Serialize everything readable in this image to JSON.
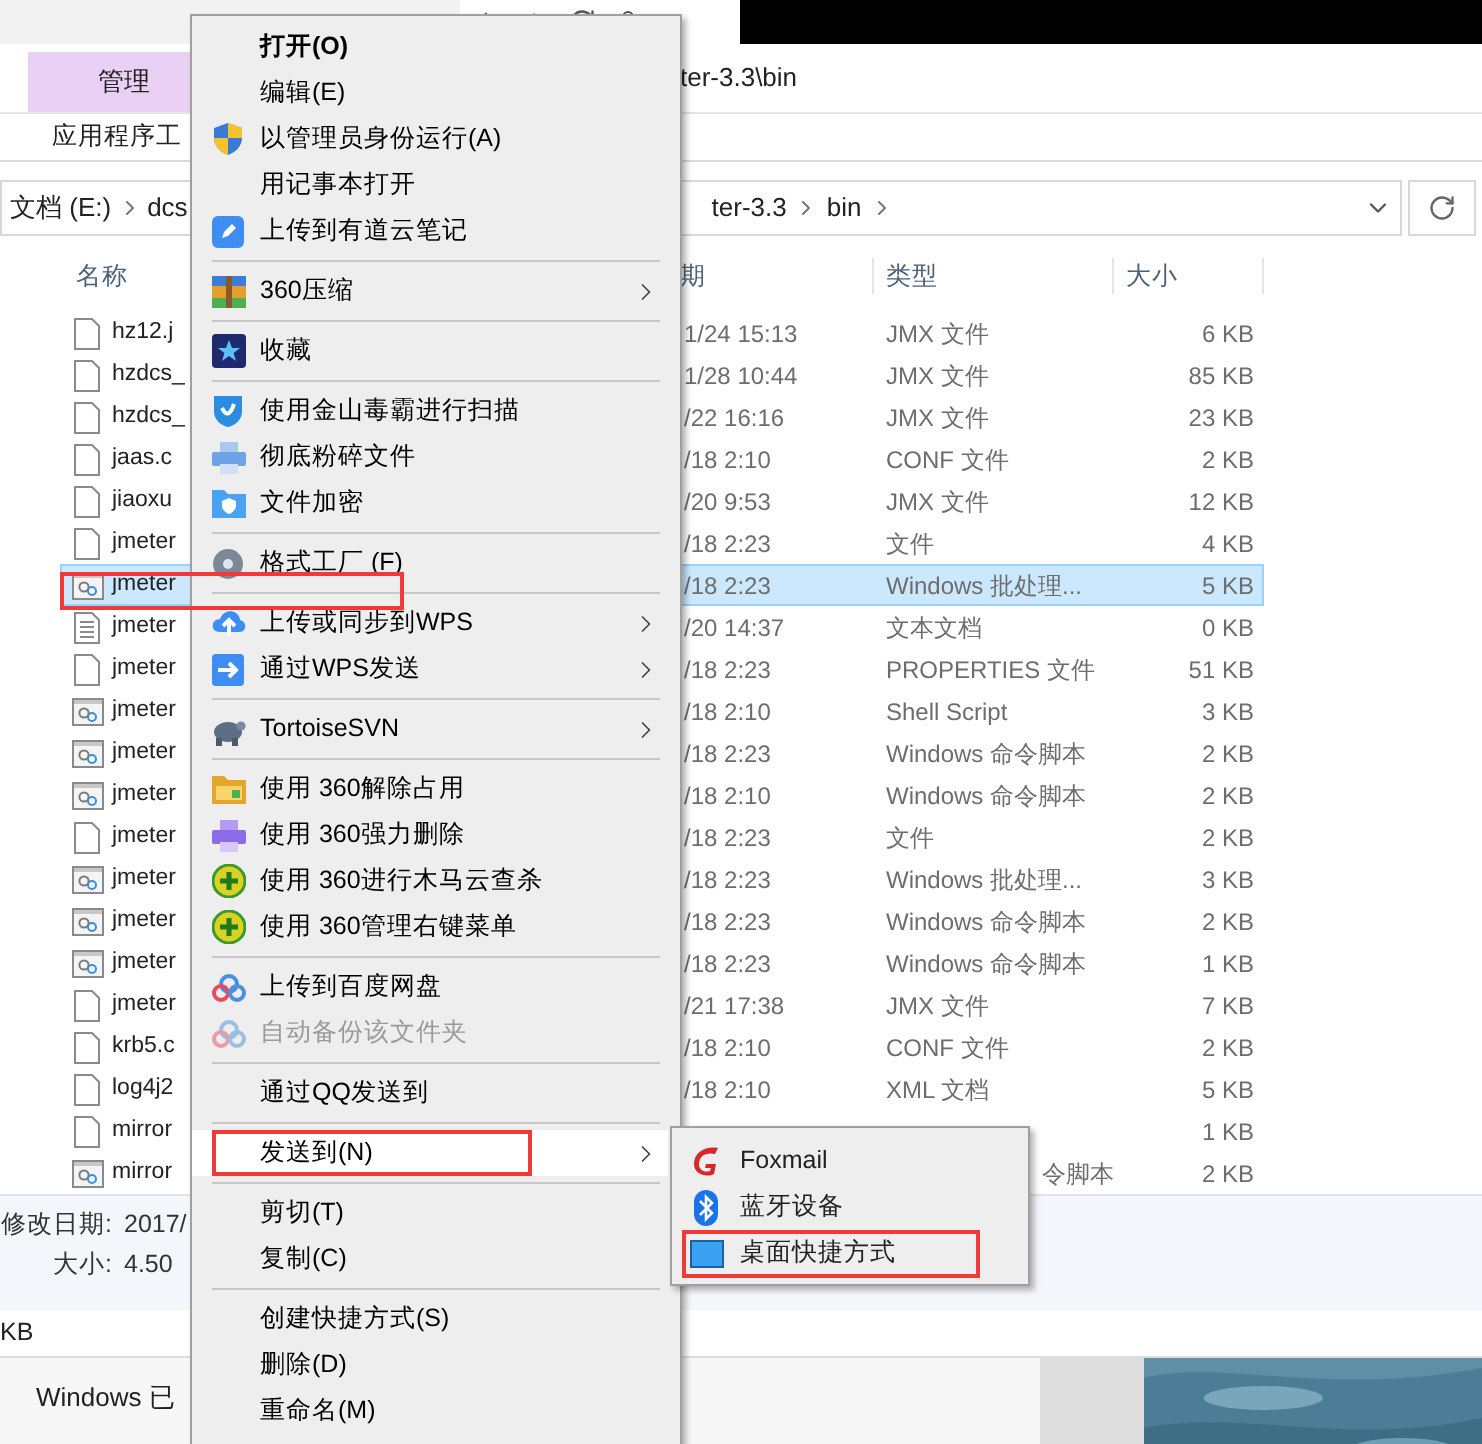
{
  "ribbon": {
    "tabs": [
      {
        "label": "管理",
        "selected": true
      }
    ],
    "tool_label": "应用程序工",
    "title": "ter-3.3\\bin"
  },
  "address": {
    "crumbs": [
      "文档 (E:)",
      "dcs",
      "ter-3.3",
      "bin"
    ]
  },
  "columns": [
    "名称",
    "期",
    "类型",
    "大小"
  ],
  "files": [
    {
      "kind": "file",
      "name": "hz12.j",
      "date": "1/24 15:13",
      "type": "JMX 文件",
      "size": "6 KB",
      "selected": false,
      "annotated": false
    },
    {
      "kind": "file",
      "name": "hzdcs_",
      "date": "1/28 10:44",
      "type": "JMX 文件",
      "size": "85 KB",
      "selected": false,
      "annotated": false
    },
    {
      "kind": "file",
      "name": "hzdcs_",
      "date": "/22 16:16",
      "type": "JMX 文件",
      "size": "23 KB",
      "selected": false,
      "annotated": false
    },
    {
      "kind": "file",
      "name": "jaas.c",
      "date": "/18 2:10",
      "type": "CONF 文件",
      "size": "2 KB",
      "selected": false,
      "annotated": false
    },
    {
      "kind": "file",
      "name": "jiaoxu",
      "date": "/20 9:53",
      "type": "JMX 文件",
      "size": "12 KB",
      "selected": false,
      "annotated": false
    },
    {
      "kind": "file",
      "name": "jmeter",
      "date": "/18 2:23",
      "type": "文件",
      "size": "4 KB",
      "selected": false,
      "annotated": false
    },
    {
      "kind": "script",
      "name": "jmeter",
      "date": "/18 2:23",
      "type": "Windows 批处理...",
      "size": "5 KB",
      "selected": true,
      "annotated": true
    },
    {
      "kind": "text",
      "name": "jmeter",
      "date": "/20 14:37",
      "type": "文本文档",
      "size": "0 KB",
      "selected": false,
      "annotated": false
    },
    {
      "kind": "file",
      "name": "jmeter",
      "date": "/18 2:23",
      "type": "PROPERTIES 文件",
      "size": "51 KB",
      "selected": false,
      "annotated": false
    },
    {
      "kind": "script",
      "name": "jmeter",
      "date": "/18 2:10",
      "type": "Shell Script",
      "size": "3 KB",
      "selected": false,
      "annotated": false
    },
    {
      "kind": "script",
      "name": "jmeter",
      "date": "/18 2:23",
      "type": "Windows 命令脚本",
      "size": "2 KB",
      "selected": false,
      "annotated": false
    },
    {
      "kind": "script",
      "name": "jmeter",
      "date": "/18 2:10",
      "type": "Windows 命令脚本",
      "size": "2 KB",
      "selected": false,
      "annotated": false
    },
    {
      "kind": "file",
      "name": "jmeter",
      "date": "/18 2:23",
      "type": "文件",
      "size": "2 KB",
      "selected": false,
      "annotated": false
    },
    {
      "kind": "script",
      "name": "jmeter",
      "date": "/18 2:23",
      "type": "Windows 批处理...",
      "size": "3 KB",
      "selected": false,
      "annotated": false
    },
    {
      "kind": "script",
      "name": "jmeter",
      "date": "/18 2:23",
      "type": "Windows 命令脚本",
      "size": "2 KB",
      "selected": false,
      "annotated": false
    },
    {
      "kind": "script",
      "name": "jmeter",
      "date": "/18 2:23",
      "type": "Windows 命令脚本",
      "size": "1 KB",
      "selected": false,
      "annotated": false
    },
    {
      "kind": "file",
      "name": "jmeter",
      "date": "/21 17:38",
      "type": "JMX 文件",
      "size": "7 KB",
      "selected": false,
      "annotated": false
    },
    {
      "kind": "file",
      "name": "krb5.c",
      "date": "/18 2:10",
      "type": "CONF 文件",
      "size": "2 KB",
      "selected": false,
      "annotated": false
    },
    {
      "kind": "file",
      "name": "log4j2",
      "date": "/18 2:10",
      "type": "XML 文档",
      "size": "5 KB",
      "selected": false,
      "annotated": false
    },
    {
      "kind": "file",
      "name": "mirror",
      "size": "1 KB",
      "selected": false,
      "annotated": false
    },
    {
      "kind": "script",
      "name": "mirror",
      "type": "令脚本",
      "partial": true,
      "size": "2 KB",
      "selected": false,
      "annotated": false
    }
  ],
  "details": [
    {
      "label": "修改日期:",
      "value": "2017/"
    },
    {
      "label": "大小:",
      "value": "4.50"
    }
  ],
  "status_bar": "KB",
  "desktop": {
    "notice": "Windows 已"
  },
  "context_menu": {
    "items": [
      {
        "kind": "default",
        "label": "打开(O)",
        "disabled": false,
        "submenu": false,
        "selected": false,
        "annotated": false
      },
      {
        "kind": "item",
        "label": "编辑(E)",
        "disabled": false,
        "submenu": false,
        "selected": false,
        "annotated": false
      },
      {
        "kind": "item",
        "label": "以管理员身份运行(A)",
        "disabled": false,
        "submenu": false,
        "selected": false,
        "annotated": false
      },
      {
        "kind": "item",
        "label": "用记事本打开",
        "disabled": false,
        "submenu": false,
        "selected": false,
        "annotated": false
      },
      {
        "kind": "item",
        "label": "上传到有道云笔记",
        "disabled": false,
        "submenu": false,
        "selected": false,
        "annotated": false
      },
      {
        "kind": "separator"
      },
      {
        "kind": "item",
        "label": "360压缩",
        "disabled": false,
        "submenu": true,
        "selected": false,
        "annotated": false
      },
      {
        "kind": "separator"
      },
      {
        "kind": "item",
        "label": "收藏",
        "disabled": false,
        "submenu": false,
        "selected": false,
        "annotated": false
      },
      {
        "kind": "separator"
      },
      {
        "kind": "item",
        "label": "使用金山毒霸进行扫描",
        "disabled": false,
        "submenu": false,
        "selected": false,
        "annotated": false
      },
      {
        "kind": "item",
        "label": "彻底粉碎文件",
        "disabled": false,
        "submenu": false,
        "selected": false,
        "annotated": false
      },
      {
        "kind": "item",
        "label": "文件加密",
        "disabled": false,
        "submenu": false,
        "selected": false,
        "annotated": false
      },
      {
        "kind": "separator"
      },
      {
        "kind": "item",
        "label": "格式工厂 (F)",
        "disabled": false,
        "submenu": false,
        "selected": false,
        "annotated": false
      },
      {
        "kind": "separator"
      },
      {
        "kind": "item",
        "label": "上传或同步到WPS",
        "disabled": false,
        "submenu": true,
        "selected": false,
        "annotated": false
      },
      {
        "kind": "item",
        "label": "通过WPS发送",
        "disabled": false,
        "submenu": true,
        "selected": false,
        "annotated": false
      },
      {
        "kind": "separator"
      },
      {
        "kind": "item",
        "label": "TortoiseSVN",
        "disabled": false,
        "submenu": true,
        "selected": false,
        "annotated": false
      },
      {
        "kind": "separator"
      },
      {
        "kind": "item",
        "label": "使用 360解除占用",
        "disabled": false,
        "submenu": false,
        "selected": false,
        "annotated": false
      },
      {
        "kind": "item",
        "label": "使用 360强力删除",
        "disabled": false,
        "submenu": false,
        "selected": false,
        "annotated": false
      },
      {
        "kind": "item",
        "label": "使用 360进行木马云查杀",
        "disabled": false,
        "submenu": false,
        "selected": false,
        "annotated": false
      },
      {
        "kind": "item",
        "label": "使用 360管理右键菜单",
        "disabled": false,
        "submenu": false,
        "selected": false,
        "annotated": false
      },
      {
        "kind": "separator"
      },
      {
        "kind": "item",
        "label": "上传到百度网盘",
        "disabled": false,
        "submenu": false,
        "selected": false,
        "annotated": false
      },
      {
        "kind": "item",
        "label": "自动备份该文件夹",
        "disabled": true,
        "submenu": false,
        "selected": false,
        "annotated": false
      },
      {
        "kind": "separator"
      },
      {
        "kind": "item",
        "label": "通过QQ发送到",
        "disabled": false,
        "submenu": false,
        "selected": false,
        "annotated": false
      },
      {
        "kind": "separator"
      },
      {
        "kind": "item",
        "label": "发送到(N)",
        "disabled": false,
        "submenu": true,
        "selected": true,
        "annotated": true
      },
      {
        "kind": "separator"
      },
      {
        "kind": "item",
        "label": "剪切(T)",
        "disabled": false,
        "submenu": false,
        "selected": false,
        "annotated": false
      },
      {
        "kind": "item",
        "label": "复制(C)",
        "disabled": false,
        "submenu": false,
        "selected": false,
        "annotated": false
      },
      {
        "kind": "separator"
      },
      {
        "kind": "item",
        "label": "创建快捷方式(S)",
        "disabled": false,
        "submenu": false,
        "selected": false,
        "annotated": false
      },
      {
        "kind": "item",
        "label": "删除(D)",
        "disabled": false,
        "submenu": false,
        "selected": false,
        "annotated": false
      },
      {
        "kind": "item",
        "label": "重命名(M)",
        "disabled": false,
        "submenu": false,
        "selected": false,
        "annotated": false
      }
    ]
  },
  "submenu": {
    "items": [
      {
        "label": "Foxmail",
        "annotated": false
      },
      {
        "label": "蓝牙设备",
        "annotated": false
      },
      {
        "label": "桌面快捷方式",
        "annotated": true
      }
    ]
  }
}
